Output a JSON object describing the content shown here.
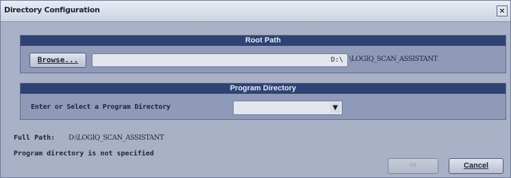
{
  "dialog": {
    "title": "Directory Configuration",
    "close_glyph": "×"
  },
  "root_path": {
    "header": "Root Path",
    "browse_label": "Browse...",
    "drive": "D:\\",
    "folder": "\\LOGIQ_SCAN_ASSISTANT"
  },
  "program_directory": {
    "header": "Program Directory",
    "prompt": "Enter or Select a Program Directory",
    "selected_value": "",
    "dropdown_arrow": "▼"
  },
  "full_path": {
    "label": "Full Path:",
    "value": "D:\\LOGIQ_SCAN_ASSISTANT"
  },
  "status": "Program directory is not specified",
  "buttons": {
    "ok": "OK",
    "cancel": "Cancel"
  },
  "colors": {
    "panel_header": "#2e4274",
    "dialog_bg": "#a9b1c6",
    "panel_bg": "#8f9ab8"
  }
}
